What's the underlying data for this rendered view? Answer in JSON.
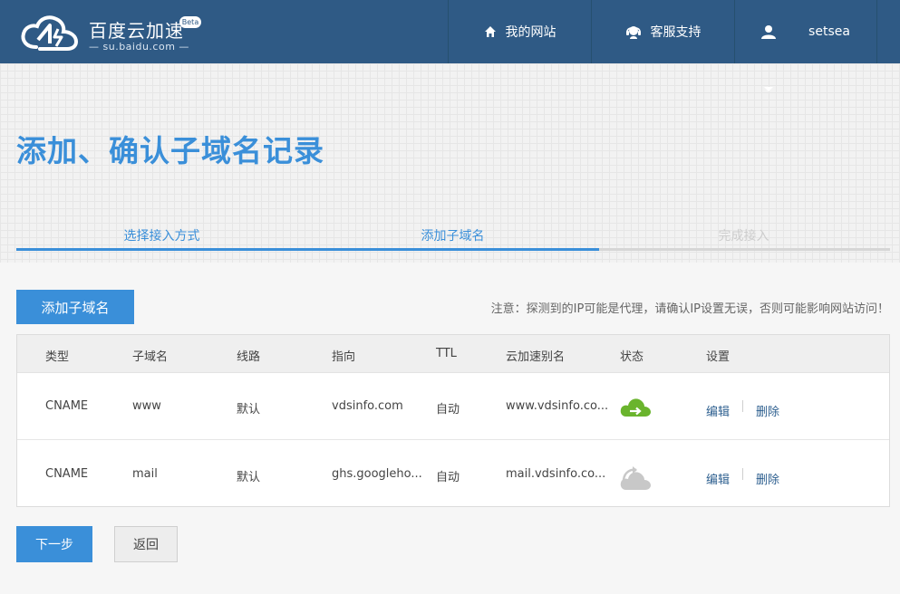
{
  "header": {
    "logo_title": "百度云加速",
    "logo_sub": "— su.baidu.com —",
    "beta": "Beta",
    "nav": {
      "my_site": "我的网站",
      "support": "客服支持",
      "user": "setsea"
    }
  },
  "page": {
    "title": "添加、确认子域名记录"
  },
  "steps": [
    {
      "label": "选择接入方式",
      "state": "done"
    },
    {
      "label": "添加子域名",
      "state": "active"
    },
    {
      "label": "完成接入",
      "state": "pending"
    }
  ],
  "toolbar": {
    "add_button": "添加子域名",
    "notice": "注意：探测到的IP可能是代理，请确认IP设置无误，否则可能影响网站访问！"
  },
  "table": {
    "headers": [
      "类型",
      "子域名",
      "线路",
      "指向",
      "TTL",
      "云加速别名",
      "状态",
      "设置"
    ],
    "rows": [
      {
        "type": "CNAME",
        "subdomain": "www",
        "line": "默认",
        "target": "vdsinfo.com",
        "ttl": "自动",
        "alias": "www.vdsinfo.co...",
        "status_icon": "cloud-accelerated-icon",
        "edit": "编辑",
        "delete": "删除"
      },
      {
        "type": "CNAME",
        "subdomain": "mail",
        "line": "默认",
        "target": "ghs.googleho...",
        "ttl": "自动",
        "alias": "mail.vdsinfo.co...",
        "status_icon": "cloud-bypass-icon",
        "edit": "编辑",
        "delete": "删除"
      }
    ]
  },
  "footer": {
    "next_button": "下一步",
    "back_button": "返回"
  },
  "colors": {
    "header_bg": "#2f5a85",
    "accent": "#3a8fd9",
    "status_on": "#6ab42d",
    "status_off": "#c8c8c8"
  }
}
